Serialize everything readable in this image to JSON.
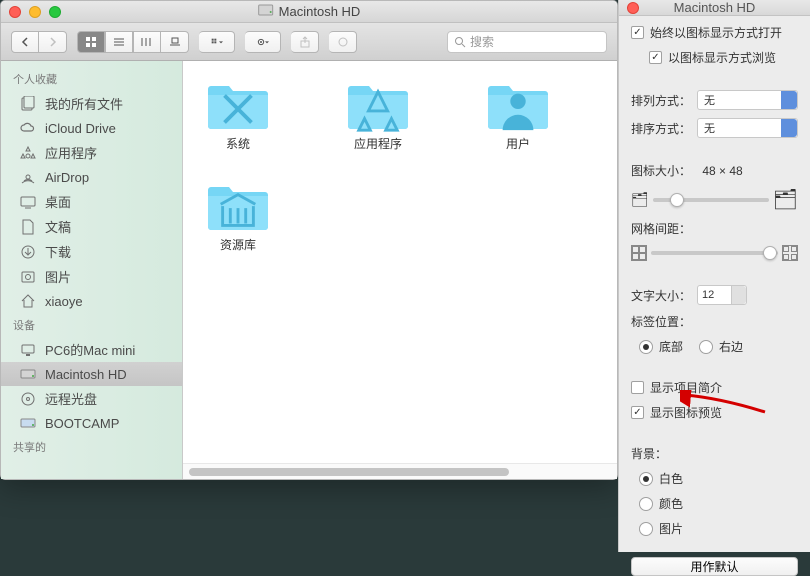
{
  "finder": {
    "title": "Macintosh HD",
    "search_placeholder": "搜索",
    "sidebar": {
      "favorites_header": "个人收藏",
      "favorites": [
        {
          "label": "我的所有文件",
          "icon": "all-files"
        },
        {
          "label": "iCloud Drive",
          "icon": "cloud"
        },
        {
          "label": "应用程序",
          "icon": "apps"
        },
        {
          "label": "AirDrop",
          "icon": "airdrop"
        },
        {
          "label": "桌面",
          "icon": "desktop"
        },
        {
          "label": "文稿",
          "icon": "documents"
        },
        {
          "label": "下载",
          "icon": "downloads"
        },
        {
          "label": "图片",
          "icon": "pictures"
        },
        {
          "label": "xiaoye",
          "icon": "home"
        }
      ],
      "devices_header": "设备",
      "devices": [
        {
          "label": "PC6的Mac mini",
          "icon": "computer",
          "selected": false
        },
        {
          "label": "Macintosh HD",
          "icon": "hdd",
          "selected": true
        },
        {
          "label": "远程光盘",
          "icon": "disc",
          "selected": false
        },
        {
          "label": "BOOTCAMP",
          "icon": "hdd2",
          "selected": false
        }
      ],
      "shared_header": "共享的"
    },
    "folders": [
      {
        "label": "系统",
        "emblem": "X"
      },
      {
        "label": "应用程序",
        "emblem": "A"
      },
      {
        "label": "用户",
        "emblem": "user"
      },
      {
        "label": "资源库",
        "emblem": "lib"
      }
    ]
  },
  "options": {
    "title": "Macintosh HD",
    "always_icon_view": "始终以图标显示方式打开",
    "browse_icon_view": "以图标显示方式浏览",
    "sort_by_label": "排列方式：",
    "sort_by_value": "无",
    "order_by_label": "排序方式：",
    "order_by_value": "无",
    "icon_size_label": "图标大小：",
    "icon_size_value": "48 × 48",
    "grid_spacing_label": "网格间距：",
    "text_size_label": "文字大小：",
    "text_size_value": "12",
    "label_pos_label": "标签位置：",
    "label_pos_bottom": "底部",
    "label_pos_right": "右边",
    "show_item_info": "显示项目简介",
    "show_icon_preview": "显示图标预览",
    "background_label": "背景：",
    "bg_white": "白色",
    "bg_color": "颜色",
    "bg_picture": "图片",
    "use_defaults": "用作默认"
  }
}
